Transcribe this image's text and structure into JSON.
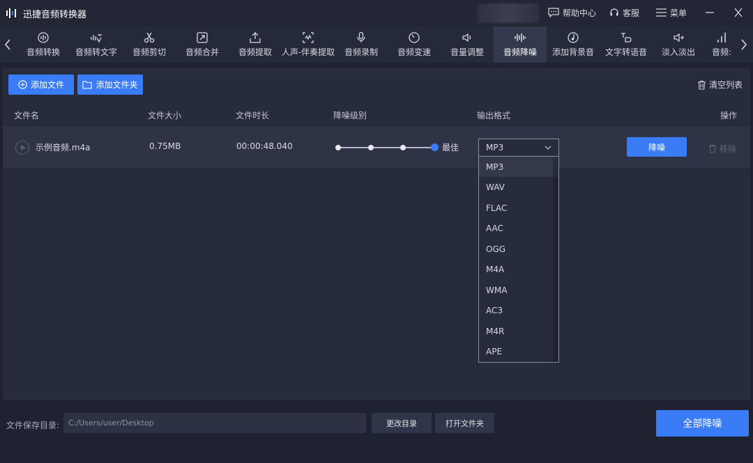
{
  "app": {
    "title": "迅捷音频转换器"
  },
  "titlebar": {
    "help": "帮助中心",
    "service": "客服",
    "menu": "菜单"
  },
  "tools": [
    {
      "label": "音频转换",
      "icon": "audio-convert-icon"
    },
    {
      "label": "音频转文字",
      "icon": "audio-to-text-icon"
    },
    {
      "label": "音频剪切",
      "icon": "scissors-icon"
    },
    {
      "label": "音频合并",
      "icon": "merge-icon"
    },
    {
      "label": "音频提取",
      "icon": "extract-icon"
    },
    {
      "label": "人声-伴奏提取",
      "icon": "vocal-extract-icon"
    },
    {
      "label": "音频录制",
      "icon": "microphone-icon"
    },
    {
      "label": "音频变速",
      "icon": "speed-icon"
    },
    {
      "label": "音量调整",
      "icon": "volume-icon"
    },
    {
      "label": "音频降噪",
      "icon": "denoise-icon"
    },
    {
      "label": "添加背景音",
      "icon": "background-music-icon"
    },
    {
      "label": "文字转语音",
      "icon": "text-to-speech-icon"
    },
    {
      "label": "淡入淡出",
      "icon": "fade-icon"
    },
    {
      "label": "音频:",
      "icon": "audio-bars-icon"
    }
  ],
  "active_tool": "音频降噪",
  "actions": {
    "add_file": "添加文件",
    "add_folder": "添加文件夹",
    "clear_list": "清空列表"
  },
  "columns": {
    "name": "文件名",
    "size": "文件大小",
    "duration": "文件时长",
    "level": "降噪级别",
    "format": "输出格式",
    "ops": "操作"
  },
  "file": {
    "name": "示例音频.m4a",
    "size": "0.75MB",
    "duration": "00:00:48.040",
    "level_label": "最佳",
    "level": 4,
    "level_max": 4,
    "format": "MP3",
    "action": "降噪",
    "remove": "移除"
  },
  "format_options": [
    "MP3",
    "WAV",
    "FLAC",
    "AAC",
    "OGG",
    "M4A",
    "WMA",
    "AC3",
    "M4R",
    "APE"
  ],
  "bottom": {
    "save_dir_label": "文件保存目录:",
    "save_dir": "C:/Users/user/Desktop",
    "change_dir": "更改目录",
    "open_folder": "打开文件夹",
    "denoise_all": "全部降噪"
  }
}
